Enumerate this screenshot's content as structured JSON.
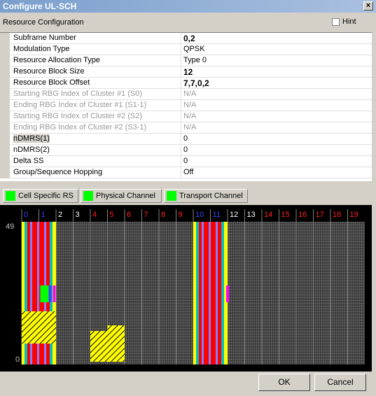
{
  "window": {
    "title": "Configure UL-SCH",
    "close_label": "×"
  },
  "section": {
    "title": "Resource Configuration",
    "hint_label": "Hint",
    "hint_checked": false
  },
  "rows": [
    {
      "label": "Subframe Number",
      "value": "0,2",
      "bold": true
    },
    {
      "label": "Modulation Type",
      "value": "QPSK"
    },
    {
      "label": "Resource Allocation Type",
      "value": "Type 0"
    },
    {
      "label": "Resource Block Size",
      "value": "12",
      "bold": true
    },
    {
      "label": "Resource Block Offset",
      "value": "7,7,0,2",
      "bold": true
    },
    {
      "label": "Starting RBG Index of Cluster #1 (S0)",
      "value": "N/A",
      "disabled": true
    },
    {
      "label": "Ending RBG Index of Cluster #1 (S1-1)",
      "value": "N/A",
      "disabled": true
    },
    {
      "label": "Starting RBG Index of Cluster #2 (S2)",
      "value": "N/A",
      "disabled": true
    },
    {
      "label": "Ending RBG Index of Cluster #2 (S3-1)",
      "value": "N/A",
      "disabled": true
    },
    {
      "label": "nDMRS(1)",
      "value": "0",
      "highlight": true
    },
    {
      "label": "nDMRS(2)",
      "value": "0"
    },
    {
      "label": "Delta SS",
      "value": "0"
    },
    {
      "label": "Group/Sequence Hopping",
      "value": "Off"
    }
  ],
  "legend": {
    "cell_specific": "Cell Specific RS",
    "physical": "Physical Channel",
    "transport": "Transport Channel",
    "color": "#00ff00"
  },
  "resource_grid": {
    "subframes": [
      "0",
      "1",
      "2",
      "3",
      "4",
      "5",
      "6",
      "7",
      "8",
      "9",
      "10",
      "11",
      "12",
      "13",
      "14",
      "15",
      "16",
      "17",
      "18",
      "19"
    ],
    "subframe_colors": [
      "#4040ff",
      "#4040ff",
      "#ffffff",
      "#ffffff",
      "#ff2020",
      "#ff2020",
      "#ff2020",
      "#ff2020",
      "#ff2020",
      "#ff2020",
      "#4040ff",
      "#4040ff",
      "#ffffff",
      "#ffffff",
      "#ff2020",
      "#ff2020",
      "#ff2020",
      "#ff2020",
      "#ff2020",
      "#ff2020"
    ],
    "y_top_label": "49",
    "y_bottom_label": "0",
    "total_rb": 50
  },
  "buttons": {
    "ok": "OK",
    "cancel": "Cancel"
  }
}
